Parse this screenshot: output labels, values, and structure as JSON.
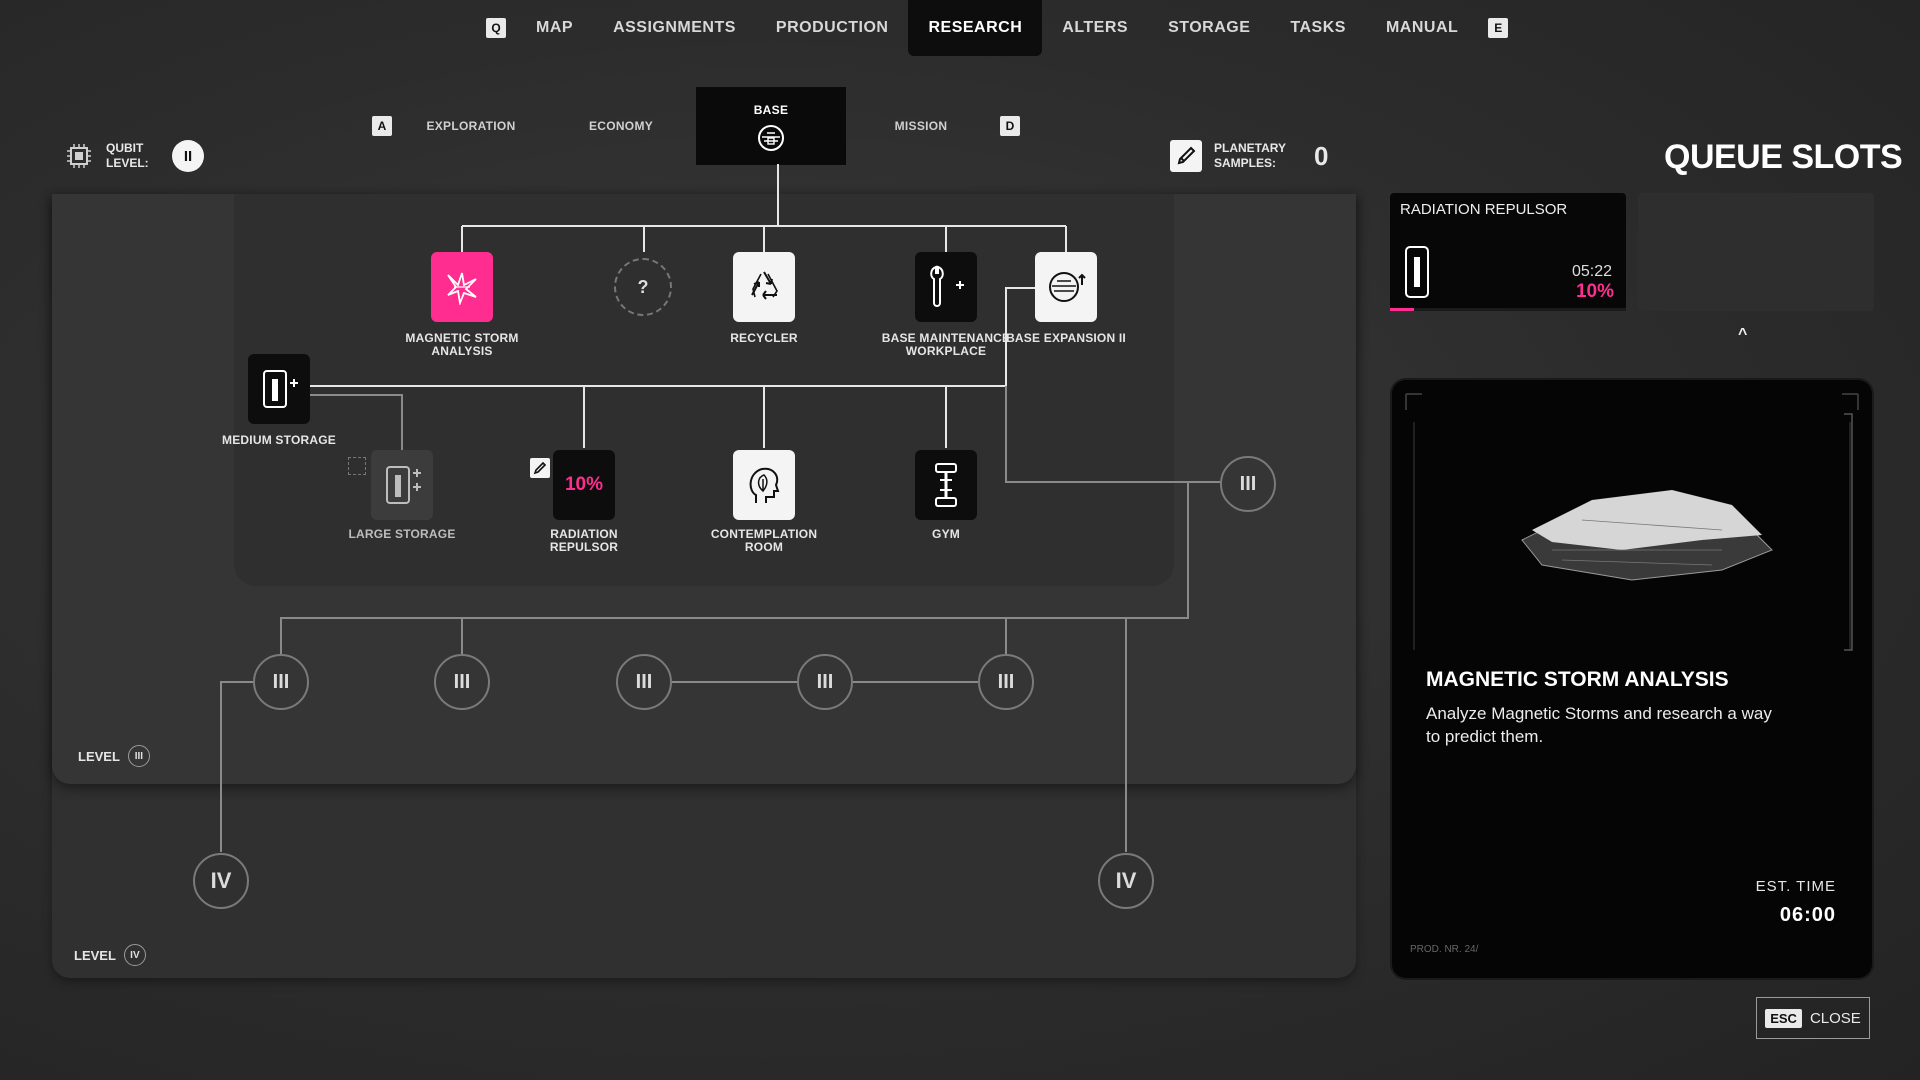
{
  "top_nav": {
    "left_key": "Q",
    "right_key": "E",
    "tabs": [
      {
        "label": "MAP"
      },
      {
        "label": "ASSIGNMENTS"
      },
      {
        "label": "PRODUCTION"
      },
      {
        "label": "RESEARCH",
        "active": true
      },
      {
        "label": "ALTERS"
      },
      {
        "label": "STORAGE"
      },
      {
        "label": "TASKS"
      },
      {
        "label": "MANUAL"
      }
    ]
  },
  "sub_nav": {
    "left_key": "A",
    "right_key": "D",
    "tabs": [
      {
        "label": "EXPLORATION"
      },
      {
        "label": "ECONOMY"
      },
      {
        "label": "BASE",
        "active": true
      },
      {
        "label": "MISSION"
      }
    ]
  },
  "qubit": {
    "label": "QUBIT LEVEL:",
    "level": "II"
  },
  "planetary": {
    "label": "PLANETARY SAMPLES:",
    "value": "0"
  },
  "research_tree": {
    "level_iii_label": "LEVEL",
    "level_iii_numeral": "III",
    "level_iv_label": "LEVEL",
    "level_iv_numeral": "IV",
    "nodes": {
      "magnetic_storm": {
        "label": "MAGNETIC STORM ANALYSIS"
      },
      "unknown": {
        "label": "?"
      },
      "recycler": {
        "label": "RECYCLER"
      },
      "base_maintenance": {
        "label": "BASE MAINTENANCE WORKPLACE"
      },
      "base_expansion": {
        "label": "BASE EXPANSION II"
      },
      "medium_storage": {
        "label": "MEDIUM STORAGE"
      },
      "large_storage": {
        "label": "LARGE STORAGE"
      },
      "radiation_repulsor": {
        "label": "RADIATION REPULSOR",
        "progress_text": "10%"
      },
      "contemplation_room": {
        "label": "CONTEMPLATION ROOM"
      },
      "gym": {
        "label": "GYM"
      }
    },
    "locked_rings": {
      "iii": "III",
      "iv": "IV"
    }
  },
  "queue": {
    "title": "QUEUE SLOTS",
    "active_item": {
      "name": "RADIATION REPULSOR",
      "time": "05:22",
      "progress_text": "10%",
      "progress": 0.1
    },
    "collapse_glyph": "^"
  },
  "detail": {
    "title": "MAGNETIC STORM ANALYSIS",
    "description": "Analyze Magnetic Storms and research a way to predict them.",
    "est_time_label": "EST. TIME",
    "est_time_value": "06:00",
    "prod_nr": "PROD. NR. 24/"
  },
  "close": {
    "key": "ESC",
    "label": "CLOSE"
  },
  "colors": {
    "accent": "#ff2d8f",
    "panel": "#353535",
    "card": "#0d0d0d"
  }
}
